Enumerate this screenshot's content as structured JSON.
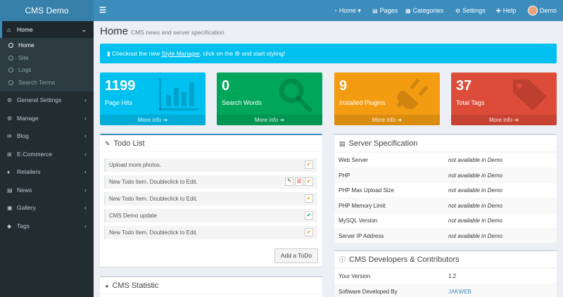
{
  "header": {
    "logo": "CMS Demo",
    "toggle_icon": "☰",
    "nav": [
      {
        "label": "Home",
        "icon": "tachometer-icon",
        "caret": "▾"
      },
      {
        "label": "Pages",
        "icon": "file-icon"
      },
      {
        "label": "Categories",
        "icon": "list-icon"
      },
      {
        "label": "Settings",
        "icon": "gears-icon"
      },
      {
        "label": "Help",
        "icon": "help-icon"
      },
      {
        "label": "Demo",
        "icon": "avatar"
      }
    ]
  },
  "sidebar": {
    "items": [
      {
        "label": "Home",
        "icon": "home-icon",
        "chevron": "⌄"
      },
      {
        "label": "General Settings",
        "icon": "cogs-icon",
        "chevron": "‹"
      },
      {
        "label": "Manage",
        "icon": "cog-icon",
        "chevron": "‹"
      },
      {
        "label": "Blog",
        "icon": "comments-icon",
        "chevron": "‹"
      },
      {
        "label": "E-Commerce",
        "icon": "cart-icon",
        "chevron": "‹"
      },
      {
        "label": "Retailers",
        "icon": "marker-icon",
        "chevron": "‹"
      },
      {
        "label": "News",
        "icon": "newspaper-icon",
        "chevron": "‹"
      },
      {
        "label": "Gallery",
        "icon": "image-icon",
        "chevron": "‹"
      },
      {
        "label": "Tags",
        "icon": "tags-icon",
        "chevron": "‹"
      }
    ],
    "sub_items": [
      "Home",
      "Site",
      "Logs",
      "Search Terms"
    ]
  },
  "page": {
    "title": "Home",
    "subtitle": "CMS news and server specification"
  },
  "callout": {
    "pre": "Checkout the new ",
    "link": "Style Manager",
    "post": ", click on the ⚙ and start styling!"
  },
  "tiles": [
    {
      "number": "1199",
      "label": "Page Hits",
      "footer": "More info ➔",
      "color": "#00c0ef",
      "icon": "bar-chart-icon"
    },
    {
      "number": "0",
      "label": "Search Words",
      "footer": "More info ➔",
      "color": "#00a65a",
      "icon": "search-icon"
    },
    {
      "number": "9",
      "label": "Installed Plugins",
      "footer": "More info ➔",
      "color": "#f39c12",
      "icon": "plug-icon"
    },
    {
      "number": "37",
      "label": "Total Tags",
      "footer": "More info ➔",
      "color": "#dd4b39",
      "icon": "tag-icon"
    }
  ],
  "todo": {
    "title": "Todo List",
    "items": [
      "Upload more photos.",
      "New Todo Item. Doubleclick to Edit.",
      "New Todo Item. Doubleclick to Edit.",
      "CMS Demo update",
      "New Todo Item. Doubleclick to Edit."
    ],
    "add_label": "Add a ToDo"
  },
  "statistic": {
    "title": "CMS Statistic"
  },
  "server": {
    "title": "Server Specification",
    "rows": [
      {
        "key": "Web Server",
        "value": "not available in Demo"
      },
      {
        "key": "PHP",
        "value": "not available in Demo"
      },
      {
        "key": "PHP Max Upload Size",
        "value": "not available in Demo"
      },
      {
        "key": "PHP Memory Limit",
        "value": "not available in Demo"
      },
      {
        "key": "MySQL Version",
        "value": "not available in Demo"
      },
      {
        "key": "Server IP Address",
        "value": "not available in Demo"
      }
    ]
  },
  "developers": {
    "title": "CMS Developers & Contributors",
    "rows": [
      {
        "key": "Your Version",
        "value": "1.2"
      },
      {
        "key": "Software Developed By",
        "value": "JAKWEB"
      }
    ]
  }
}
